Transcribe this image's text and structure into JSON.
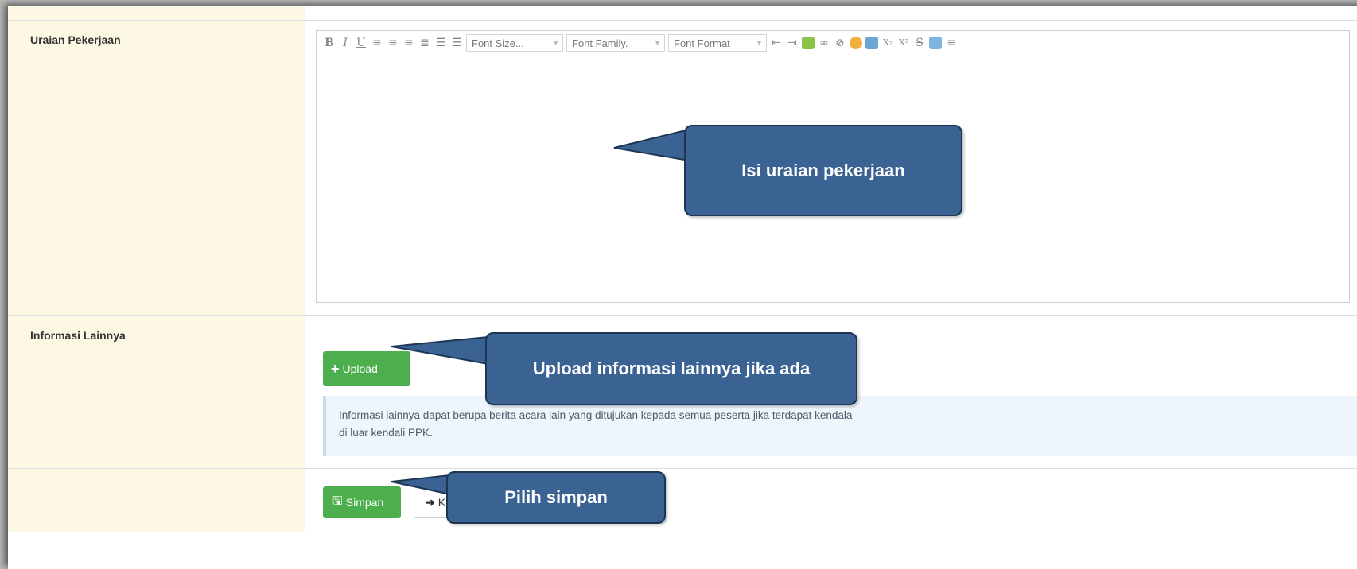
{
  "form": {
    "uraian": {
      "label": "Uraian Pekerjaan",
      "editor": {
        "toolbar": {
          "bold": "B",
          "italic": "I",
          "underline": "U",
          "font_size": "Font Size...",
          "font_family": "Font Family.",
          "font_format": "Font Format",
          "subscript": "X₂",
          "superscript": "X²",
          "strikethrough": "S"
        },
        "content": ""
      }
    },
    "informasi": {
      "label": "Informasi Lainnya",
      "upload_label": "Upload",
      "note_line1": "Informasi lainnya dapat berupa berita acara lain yang ditujukan kepada semua peserta jika terdapat kendala",
      "note_line2": "di luar kendali PPK."
    },
    "actions": {
      "simpan_label": "Simpan",
      "kembali_label": "K"
    }
  },
  "callouts": {
    "uraian": "Isi uraian pekerjaan",
    "upload": "Upload informasi lainnya jika ada",
    "simpan": "Pilih simpan"
  },
  "colors": {
    "label_bg": "#fcf8e3",
    "success": "#4cae4c",
    "callout": "#3a6292",
    "callout_border": "#1d3653",
    "info_bg": "#eef5fb"
  }
}
